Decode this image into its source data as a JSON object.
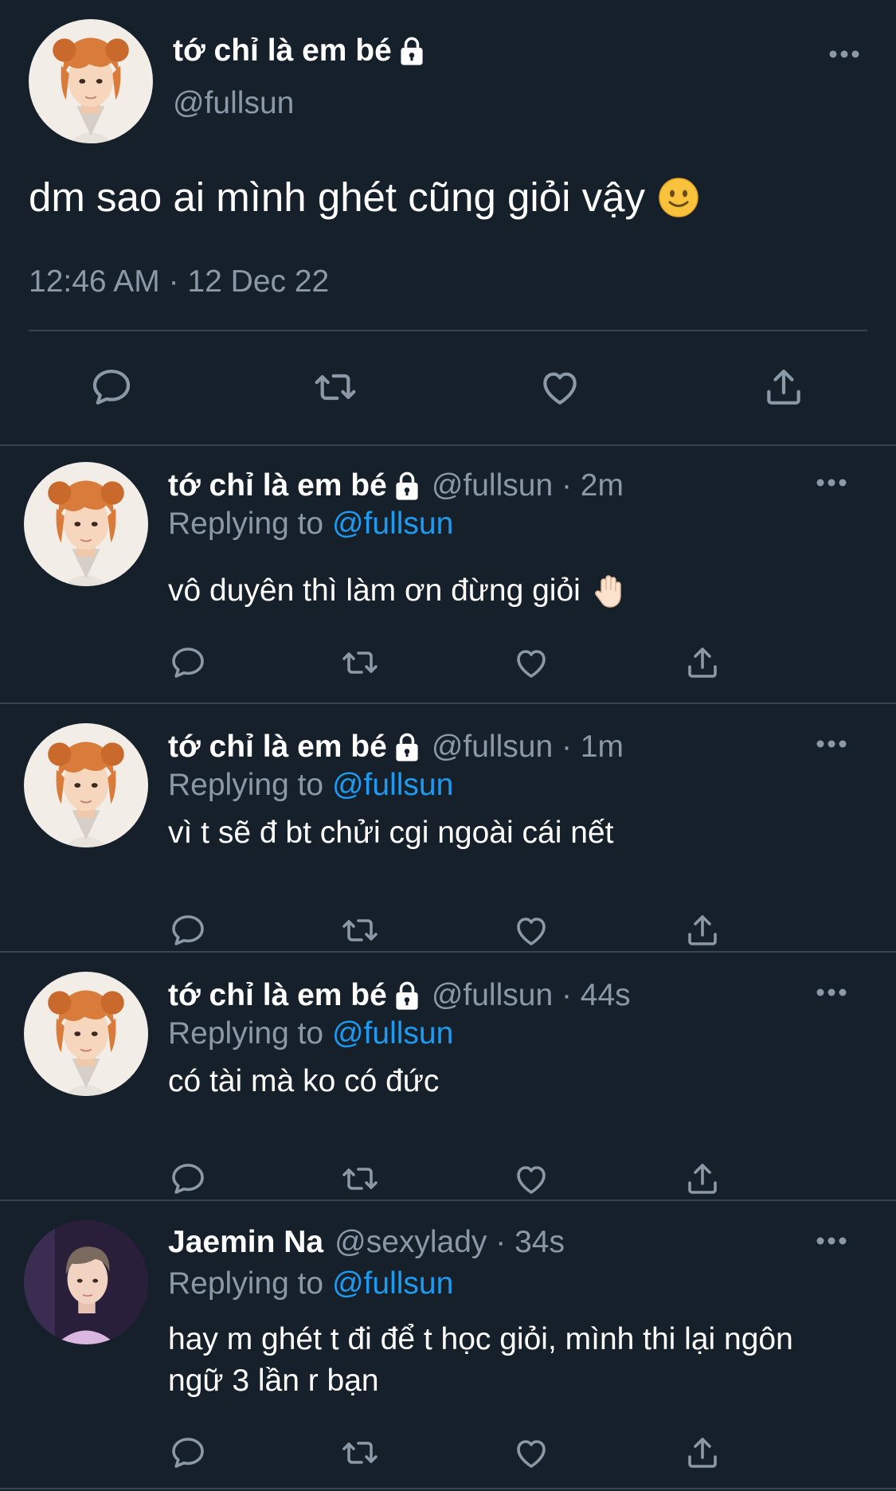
{
  "main_tweet": {
    "display_name": "tớ chỉ là em bé",
    "handle": "@fullsun",
    "text": "dm sao ai mình ghét cũng giỏi vậy",
    "emoji": "slightly-smiling-face",
    "timestamp": "12:46 AM · 12 Dec 22"
  },
  "replies": [
    {
      "display_name": "tớ chỉ là em bé",
      "handle_time": "@fullsun · 2m",
      "replying_label": "Replying to",
      "replying_to": "@fullsun",
      "text": "vô duyên thì làm ơn đừng giỏi",
      "emoji": "raised-hand"
    },
    {
      "display_name": "tớ chỉ là em bé",
      "handle_time": "@fullsun · 1m",
      "replying_label": "Replying to",
      "replying_to": "@fullsun",
      "text": "vì t sẽ đ bt chửi cgi ngoài cái nết"
    },
    {
      "display_name": "tớ chỉ là em bé",
      "handle_time": "@fullsun · 44s",
      "replying_label": "Replying to",
      "replying_to": "@fullsun",
      "text": "có tài mà ko có đức"
    },
    {
      "display_name": "Jaemin Na",
      "handle_time": "@sexylady · 34s",
      "replying_label": "Replying to",
      "replying_to": "@fullsun",
      "text": "hay m ghét t đi để t học giỏi, mình thi lại ngôn ngữ 3 lần r bạn"
    }
  ],
  "icons": [
    "reply-icon",
    "retweet-icon",
    "like-icon",
    "share-icon",
    "more-icon",
    "lock-icon"
  ],
  "colors": {
    "background": "#15202b",
    "text": "#ffffff",
    "secondary": "#8b98a5",
    "link": "#1d9bf0",
    "divider": "#38444d"
  }
}
